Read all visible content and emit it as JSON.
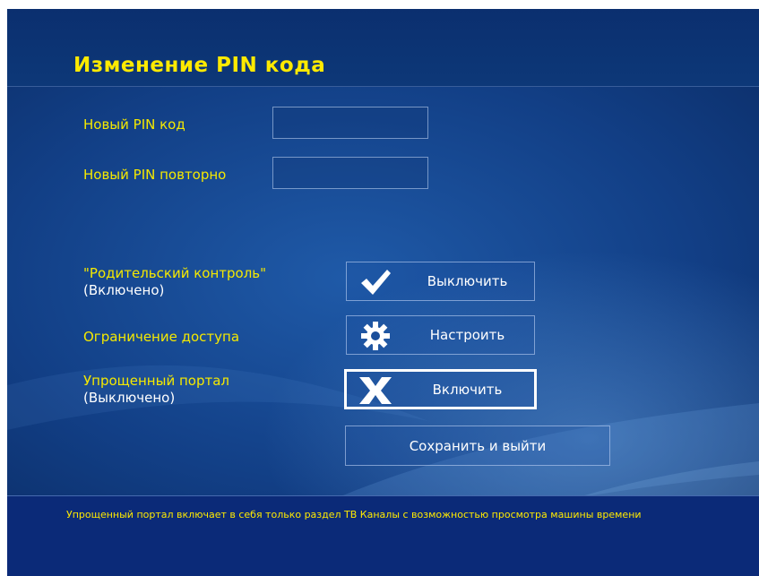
{
  "title": "Изменение PIN кода",
  "pin": {
    "new_label": "Новый PIN код",
    "repeat_label": "Новый PIN повторно",
    "new_value": "",
    "repeat_value": ""
  },
  "settings": [
    {
      "label": "\"Родительский контроль\"",
      "status": "(Включено)",
      "button": "Выключить",
      "icon": "check-icon"
    },
    {
      "label": "Ограничение доступа",
      "status": "",
      "button": "Настроить",
      "icon": "gear-icon"
    },
    {
      "label": "Упрощенный портал",
      "status": "(Выключено)",
      "button": "Включить",
      "icon": "x-icon"
    }
  ],
  "save_button": "Сохранить и выйти",
  "footer_text": "Упрощенный портал включает в себя только раздел ТВ Каналы с возможностью просмотра машины времени",
  "colors": {
    "label": "#f5e900",
    "title": "#ffea00",
    "background": "#123f86",
    "footer": "#0b2a78"
  }
}
